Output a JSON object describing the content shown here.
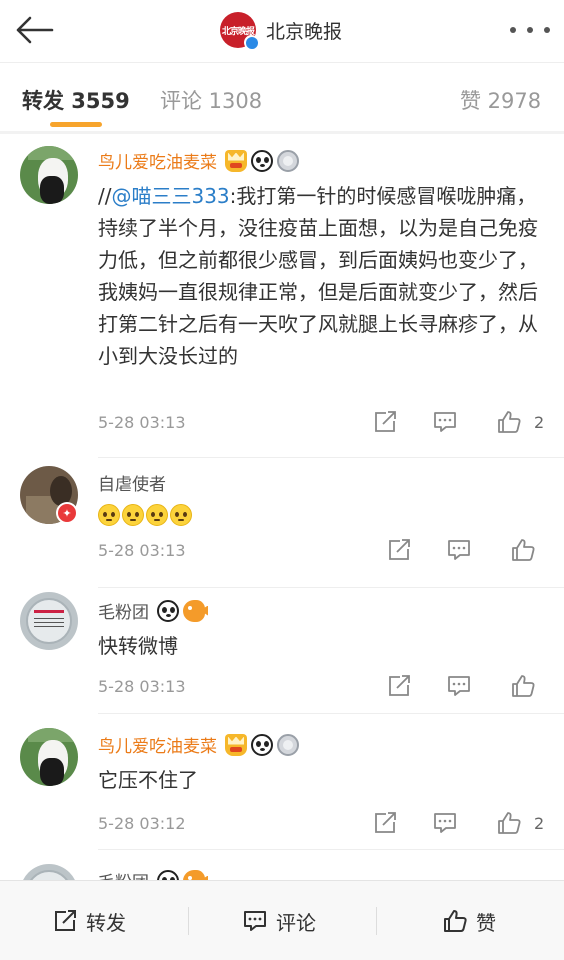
{
  "header": {
    "brand_name": "北京晚报",
    "logo_text": "北京晚报"
  },
  "tabs": {
    "repost_label": "转发 3559",
    "comment_label": "评论 1308",
    "like_label": "赞 2978"
  },
  "comments": [
    {
      "user": "鸟儿爱吃油麦菜",
      "prefix": "//",
      "mention": "@喵三三333",
      "text": ":我打第一针的时候感冒喉咙肿痛，持续了半个月，没往疫苗上面想，以为是自己免疫力低，但之前都很少感冒，到后面姨妈也变少了，我姨妈一直很规律正常，但是后面就变少了，然后打第二针之后有一天吹了风就腿上长寻麻疹了，从小到大没长过的",
      "time": "5-28 03:13",
      "likes": "2"
    },
    {
      "user": "自虐使者",
      "text": "",
      "time": "5-28 03:13",
      "likes": ""
    },
    {
      "user": "毛粉团",
      "text": "快转微博",
      "time": "5-28 03:13",
      "likes": ""
    },
    {
      "user": "鸟儿爱吃油麦菜",
      "text": "它压不住了",
      "time": "5-28 03:12",
      "likes": "2"
    },
    {
      "user": "毛粉团",
      "text": "",
      "time": "",
      "likes": ""
    }
  ],
  "bottom": {
    "repost": "转发",
    "comment": "评论",
    "like": "赞"
  },
  "colors": {
    "accent": "#f7a42c",
    "vip_name": "#eb7b18",
    "mention": "#2b7ec8",
    "brand_red": "#c8202a"
  },
  "icons": [
    "back-arrow-icon",
    "more-icon",
    "verified-icon",
    "share-icon",
    "comment-icon",
    "like-icon",
    "crown-badge-icon",
    "panda-badge-icon",
    "medal-badge-icon",
    "fish-badge-icon",
    "vip-badge-icon",
    "emoji-icon"
  ]
}
